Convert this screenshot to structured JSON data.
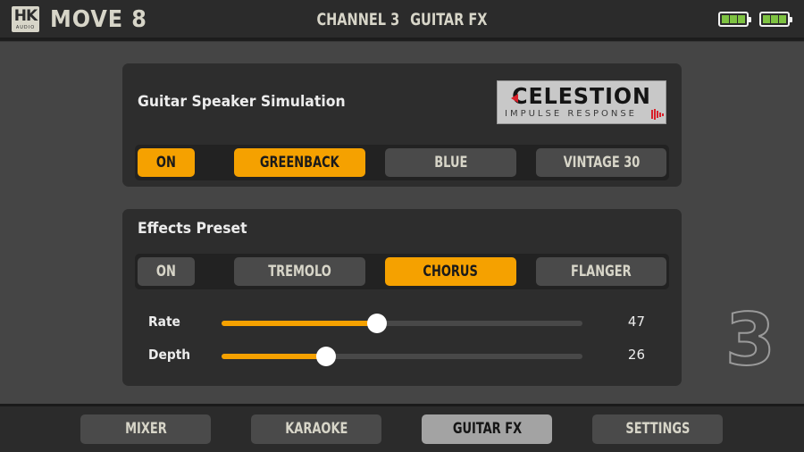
{
  "header": {
    "logo": {
      "main": "HK",
      "sub": "AUDIO"
    },
    "app_title": "MOVE 8",
    "channel": "CHANNEL 3",
    "section": "GUITAR FX",
    "batteries": [
      {
        "name": "battery-1",
        "level": 1.0,
        "color": "#7ec242"
      },
      {
        "name": "battery-2",
        "level": 1.0,
        "color": "#7ec242"
      }
    ]
  },
  "speaker_sim": {
    "title": "Guitar Speaker Simulation",
    "logo": {
      "brand": "CELESTION",
      "subtitle": "IMPULSE RESPONSE"
    },
    "on_button": {
      "label": "ON",
      "active": true
    },
    "options": [
      {
        "label": "GREENBACK",
        "active": true
      },
      {
        "label": "BLUE",
        "active": false
      },
      {
        "label": "VINTAGE 30",
        "active": false
      }
    ]
  },
  "effects": {
    "title": "Effects Preset",
    "on_button": {
      "label": "ON",
      "active": false
    },
    "options": [
      {
        "label": "TREMOLO",
        "active": false
      },
      {
        "label": "CHORUS",
        "active": true
      },
      {
        "label": "FLANGER",
        "active": false
      }
    ],
    "sliders": [
      {
        "label": "Rate",
        "value": "47",
        "percent": 43
      },
      {
        "label": "Depth",
        "value": "26",
        "percent": 29
      }
    ]
  },
  "channel_number": "3",
  "nav": {
    "items": [
      {
        "label": "MIXER",
        "active": false
      },
      {
        "label": "KARAOKE",
        "active": false
      },
      {
        "label": "GUITAR FX",
        "active": true
      },
      {
        "label": "SETTINGS",
        "active": false
      }
    ]
  },
  "colors": {
    "accent": "#f5a100",
    "battery": "#7ec242",
    "celestion_red": "#d8202a"
  }
}
